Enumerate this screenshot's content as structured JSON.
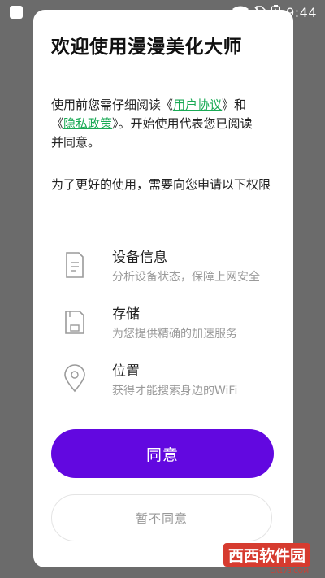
{
  "status_bar": {
    "time": "9:44",
    "icons": [
      "app-icon",
      "wifi-icon",
      "no-sim-icon",
      "battery-charging-icon"
    ]
  },
  "dialog": {
    "title": "欢迎使用漫漫美化大师",
    "notice": {
      "prefix": "使用前您需仔细阅读《",
      "user_agreement": "用户协议",
      "middle": "》和《",
      "privacy_policy": "隐私政策",
      "suffix": "》。开始使用代表您已阅读并同意。"
    },
    "permission_intro": "为了更好的使用，需要向您申请以下权限",
    "permissions": [
      {
        "icon": "device-info-icon",
        "title": "设备信息",
        "desc": "分析设备状态，保障上网安全"
      },
      {
        "icon": "storage-icon",
        "title": "存储",
        "desc": "为您提供精确的加速服务"
      },
      {
        "icon": "location-icon",
        "title": "位置",
        "desc": "获得才能搜索身边的WiFi"
      }
    ],
    "agree_label": "同意",
    "disagree_label": "暂不同意"
  },
  "watermark": {
    "text": "西西软件园",
    "sub": "CR173.COM"
  },
  "colors": {
    "accent": "#6208e0",
    "link": "#1aaa55",
    "backdrop": "#6b6b6b"
  }
}
